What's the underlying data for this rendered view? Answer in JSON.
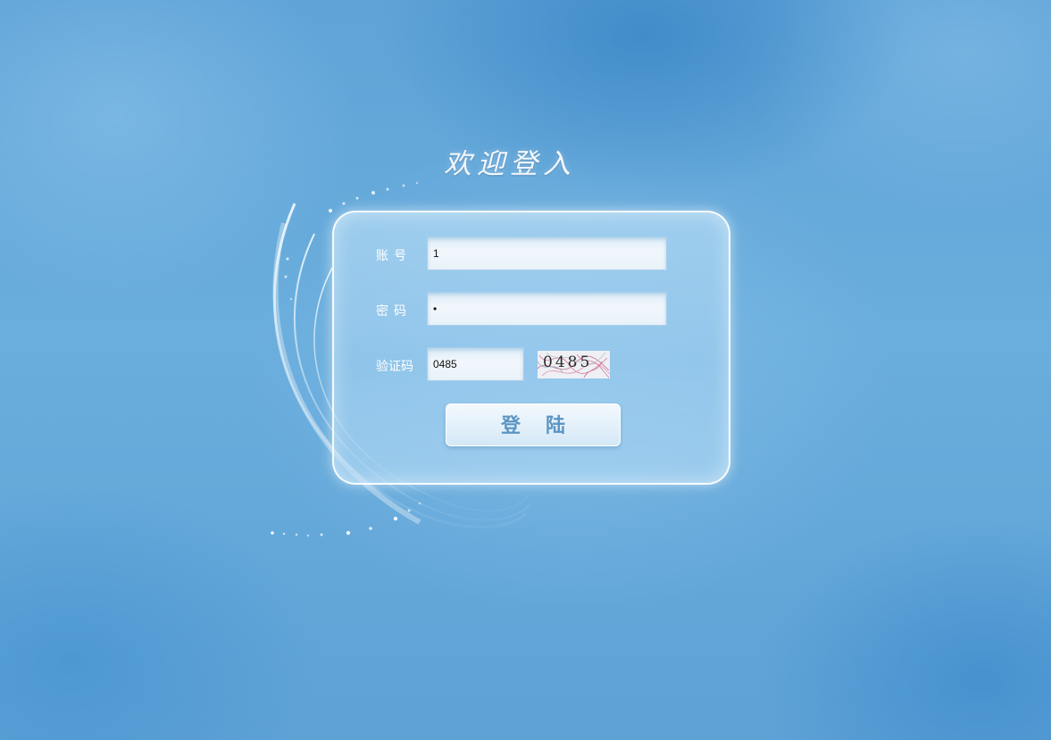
{
  "login": {
    "title": "欢迎登入",
    "account_label": "账号",
    "account_value": "1",
    "password_label": "密码",
    "password_value": "•",
    "captcha_label": "验证码",
    "captcha_value": "0485",
    "captcha_image_text": "0485",
    "submit_label": "登陆"
  },
  "colors": {
    "background": "#5fa3d7",
    "panel_border": "#ffffff",
    "button_text": "#5b95c4"
  }
}
